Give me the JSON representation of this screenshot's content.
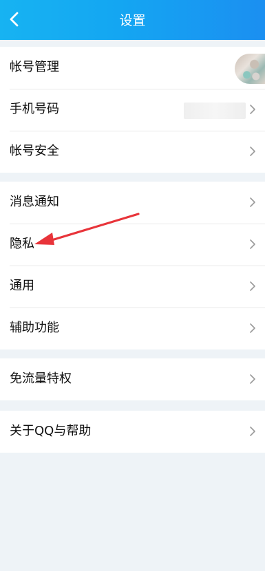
{
  "header": {
    "title": "设置"
  },
  "sections": [
    {
      "items": [
        {
          "label": "帐号管理"
        },
        {
          "label": "手机号码"
        },
        {
          "label": "帐号安全"
        }
      ]
    },
    {
      "items": [
        {
          "label": "消息通知"
        },
        {
          "label": "隐私"
        },
        {
          "label": "通用"
        },
        {
          "label": "辅助功能"
        }
      ]
    },
    {
      "items": [
        {
          "label": "免流量特权"
        }
      ]
    },
    {
      "items": [
        {
          "label": "关于QQ与帮助"
        }
      ]
    }
  ],
  "colors": {
    "header_start": "#17b3f2",
    "header_end": "#1b8ff1",
    "page_bg": "#eef3f7",
    "arrow_annotation": "#e8343a"
  },
  "icons": {
    "back": "back-chevron-icon",
    "row": "chevron-right-icon"
  }
}
